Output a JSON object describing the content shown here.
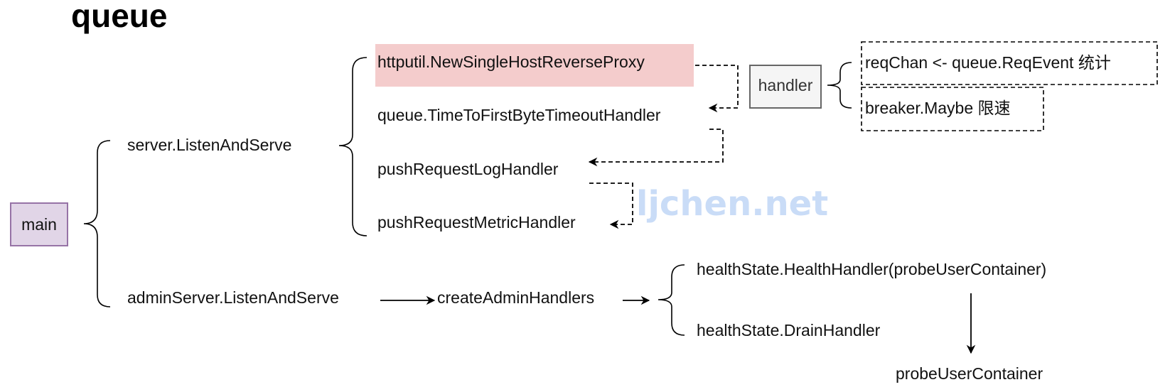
{
  "title": "queue",
  "watermark": "ljchen.net",
  "colors": {
    "main_fill": "#e1d5e7",
    "main_stroke": "#9673a6",
    "proxy_highlight": "#f4cccc",
    "handler_fill": "#f5f5f5",
    "handler_stroke": "#666666",
    "watermark": "#c9dcf7"
  },
  "nodes": {
    "main": "main",
    "server_listen": "server.ListenAndServe",
    "admin_listen": "adminServer.ListenAndServe",
    "reverse_proxy": "httputil.NewSingleHostReverseProxy",
    "ttfb_handler": "queue.TimeToFirstByteTimeoutHandler",
    "push_log": "pushRequestLogHandler",
    "push_metric": "pushRequestMetricHandler",
    "handler": "handler",
    "req_chan": "reqChan <- queue.ReqEvent 统计",
    "breaker": "breaker.Maybe 限速",
    "create_admin": "createAdminHandlers",
    "health_handler": "healthState.HealthHandler(probeUserContainer)",
    "drain_handler": "healthState.DrainHandler",
    "probe_user": "probeUserContainer"
  }
}
